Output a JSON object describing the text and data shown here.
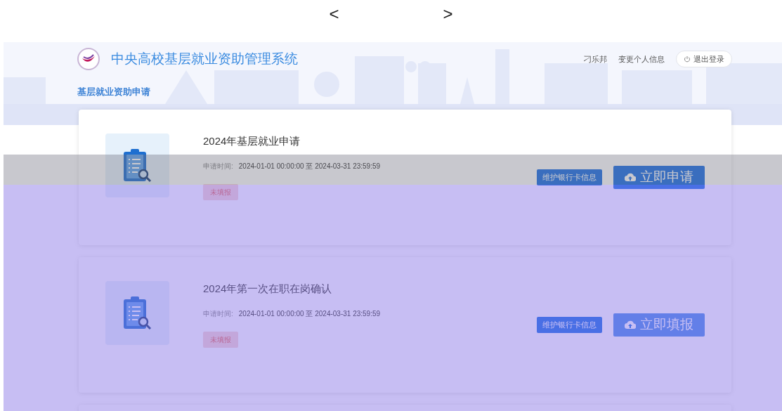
{
  "pager": {
    "prev": "<",
    "next": ">"
  },
  "header": {
    "title": "中央高校基层就业资助管理系统",
    "nav": [
      {
        "label": "基层就业资助申请",
        "selected": true
      }
    ],
    "user": "刁乐邦",
    "profile_link": "变更个人信息",
    "logout": "退出登录"
  },
  "items": [
    {
      "title": "2024年基层就业申请",
      "time_label": "申请时间:",
      "time_range": "2024-01-01 00:00:00 至 2024-03-31 23:59:59",
      "status": "未填报",
      "bank_button": "维护银行卡信息",
      "action": {
        "label": "立即申请",
        "disabled": false
      }
    },
    {
      "title": "2024年第一次在职在岗确认",
      "time_label": "申请时间:",
      "time_range": "2024-01-01 00:00:00 至 2024-03-31 23:59:59",
      "status": "未填报",
      "bank_button": "维护银行卡信息",
      "action": {
        "label": "立即填报",
        "disabled": true
      }
    }
  ]
}
